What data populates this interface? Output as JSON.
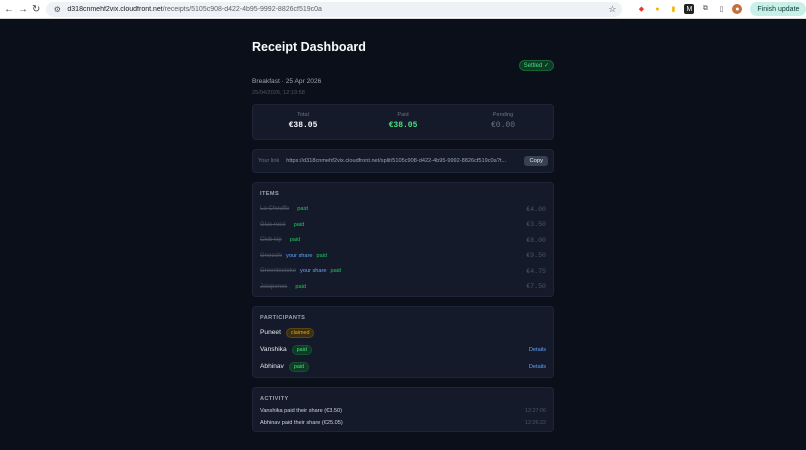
{
  "browser": {
    "url_host": "d318cnmehf2vix.cloudfront.net",
    "url_path": "/receipts/5105c908-d422-4b95-9992-8826cf519c0a",
    "finish_update_label": "Finish update",
    "ext_m_label": "M"
  },
  "header": {
    "title": "Receipt Dashboard",
    "subtitle": "Breakfast · 25 Apr 2026",
    "timestamp": "25/04/2026, 12:19:58",
    "status": "Settled ✓"
  },
  "totals": {
    "total_label": "Total",
    "total_value": "€38.05",
    "paid_label": "Paid",
    "paid_value": "€38.05",
    "pending_label": "Pending",
    "pending_value": "€0.00"
  },
  "link": {
    "label": "Your link",
    "url": "https://d318cnmehf2vix.cloudfront.net/split/5105c908-d422-4b95-9992-8826cf519c0a?t...",
    "copy_label": "Copy"
  },
  "items": {
    "title": "ITEMS",
    "rows": [
      {
        "name": "La Chouffe",
        "share": "",
        "paid": "paid",
        "price": "€4.00"
      },
      {
        "name": "Glas rosé",
        "share": "",
        "paid": "paid",
        "price": "€3.50"
      },
      {
        "name": "Club kip",
        "share": "",
        "paid": "paid",
        "price": "€8.00"
      },
      {
        "name": "Gnocchi",
        "share": "your share",
        "paid": "paid",
        "price": "€9.50"
      },
      {
        "name": "Groentestoke",
        "share": "your share",
        "paid": "paid",
        "price": "€4.75"
      },
      {
        "name": "Jalapenos",
        "share": "",
        "paid": "paid",
        "price": "€7.50"
      }
    ]
  },
  "participants": {
    "title": "PARTICIPANTS",
    "rows": [
      {
        "name": "Puneet",
        "badge": "claimed",
        "details": ""
      },
      {
        "name": "Vanshika",
        "badge": "paid",
        "details": "Details"
      },
      {
        "name": "Abhinav",
        "badge": "paid",
        "details": "Details"
      }
    ]
  },
  "activity": {
    "title": "ACTIVITY",
    "rows": [
      {
        "text": "Vanshika paid their share (€3.50)",
        "time": "12:27:06"
      },
      {
        "text": "Abhinav paid their share (€25.05)",
        "time": "12:26:22"
      }
    ]
  },
  "colors": {
    "background": "#0b0f1a",
    "card": "#141a2a",
    "paid_green": "#4ade80",
    "link_blue": "#60a5fa",
    "claimed_amber": "#f59e0b"
  }
}
